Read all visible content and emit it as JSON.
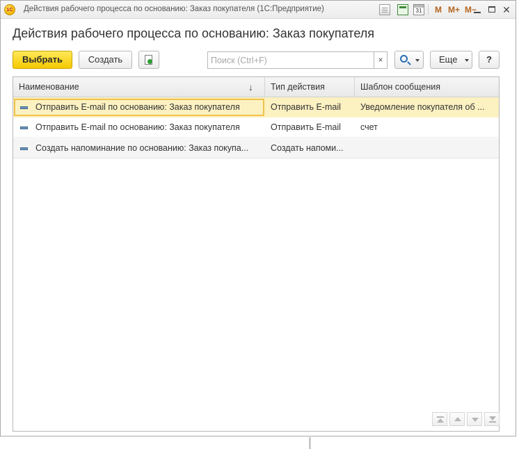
{
  "window": {
    "logo_text": "1С",
    "title": "Действия рабочего процесса по основанию: Заказ покупателя  (1С:Предприятие)",
    "calendar_day": "31",
    "memory_buttons": [
      "M",
      "M+",
      "M−"
    ],
    "close_glyph": "✕"
  },
  "form": {
    "title": "Действия рабочего процесса по основанию: Заказ покупателя"
  },
  "toolbar": {
    "select_label": "Выбрать",
    "create_label": "Создать",
    "search_placeholder": "Поиск (Ctrl+F)",
    "search_clear": "×",
    "more_label": "Еще",
    "help_label": "?"
  },
  "table": {
    "columns": [
      "Наименование",
      "Тип действия",
      "Шаблон сообщения"
    ],
    "sort_glyph": "↓",
    "rows": [
      {
        "name": "Отправить E-mail по основанию: Заказ покупателя",
        "action_type": "Отправить E-mail",
        "template": "Уведомление покупателя об ...",
        "selected": true
      },
      {
        "name": "Отправить E-mail по основанию: Заказ покупателя",
        "action_type": "Отправить E-mail",
        "template": "счет",
        "selected": false
      },
      {
        "name": "Создать напоминание по основанию: Заказ покупа...",
        "action_type": "Создать напоми...",
        "template": "",
        "selected": false
      }
    ]
  },
  "colors": {
    "primary_button": "#f5c900",
    "selected_row": "#fcf1c1",
    "selected_border": "#f0c24c",
    "accent_blue": "#2a6fb7"
  }
}
